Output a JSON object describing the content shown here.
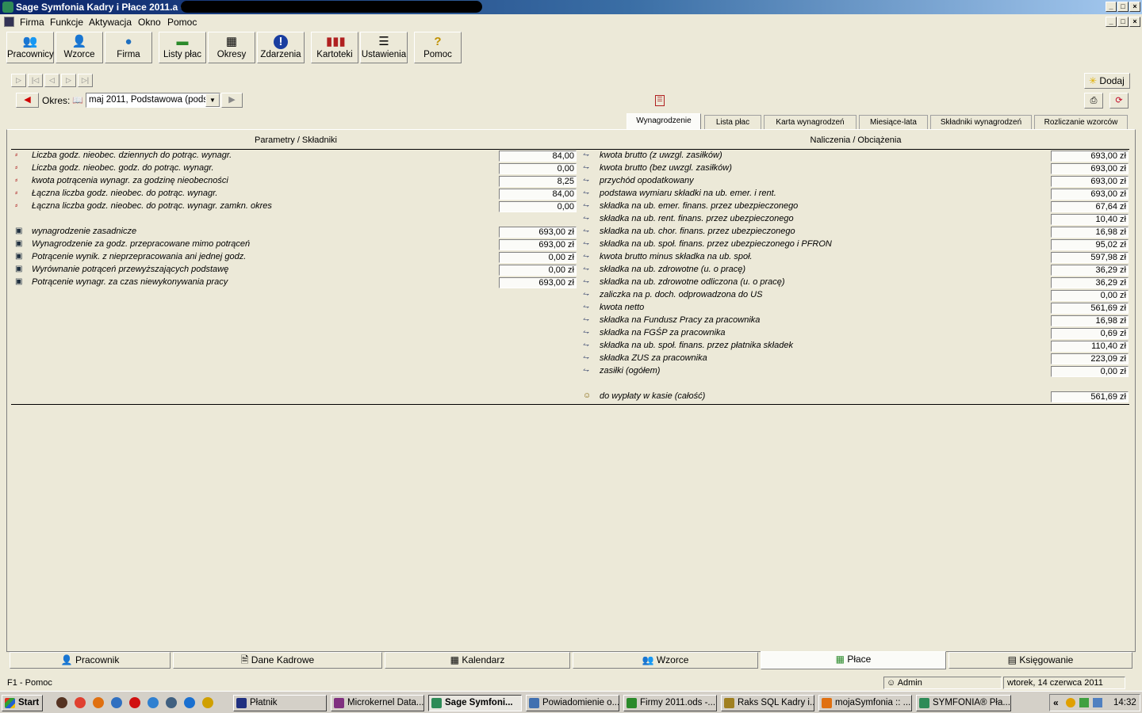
{
  "window": {
    "title": "Sage Symfonia Kadry i Płace 2011.a - "
  },
  "menu": [
    "Firma",
    "Funkcje",
    "Aktywacja",
    "Okno",
    "Pomoc"
  ],
  "toolbar": [
    {
      "label": "Pracownicy",
      "icon": "people-icon"
    },
    {
      "label": "Wzorce",
      "icon": "templates-icon"
    },
    {
      "label": "Firma",
      "icon": "globe-icon"
    },
    {
      "label": "Listy płac",
      "icon": "money-icon"
    },
    {
      "label": "Okresy",
      "icon": "calendar-icon"
    },
    {
      "label": "Zdarzenia",
      "icon": "alert-icon"
    },
    {
      "label": "Kartoteki",
      "icon": "books-icon"
    },
    {
      "label": "Ustawienia",
      "icon": "sliders-icon"
    },
    {
      "label": "Pomoc",
      "icon": "help-icon"
    }
  ],
  "period": {
    "label": "Okres:",
    "value": "maj 2011, Podstawowa (pods..."
  },
  "add_button": "Dodaj",
  "tabs": [
    "Wynagrodzenie",
    "Lista płac",
    "Karta wynagrodzeń",
    "Miesiące-lata",
    "Składniki wynagrodzeń",
    "Rozliczanie wzorców"
  ],
  "left": {
    "header": "Parametry / Składniki",
    "rows": [
      {
        "label": "Liczba godz. nieobec. dziennych do potrąc. wynagr.",
        "value": "84,00",
        "icon": "param-icon"
      },
      {
        "label": "Liczba godz. nieobec. godz. do potrąc. wynagr.",
        "value": "0,00",
        "icon": "param-icon"
      },
      {
        "label": "kwota potrącenia wynagr. za godzinę nieobecności",
        "value": "8,25",
        "icon": "param-icon"
      },
      {
        "label": "Łączna liczba godz. nieobec. do potrąc. wynagr.",
        "value": "84,00",
        "icon": "param-icon"
      },
      {
        "label": "Łączna liczba godz. nieobec. do potrąc. wynagr. zamkn. okres",
        "value": "0,00",
        "icon": "param-icon"
      },
      {
        "label": "",
        "value": "",
        "icon": ""
      },
      {
        "label": "wynagrodzenie zasadnicze",
        "value": "693,00 zł",
        "icon": "component-icon"
      },
      {
        "label": "Wynagrodzenie za godz. przepracowane mimo potrąceń",
        "value": "693,00 zł",
        "icon": "component-icon"
      },
      {
        "label": "Potrącenie wynik. z nieprzepracowania ani jednej godz.",
        "value": "0,00 zł",
        "icon": "component-icon"
      },
      {
        "label": "Wyrównanie potrąceń przewyższających podstawę",
        "value": "0,00 zł",
        "icon": "component-icon"
      },
      {
        "label": "Potrącenie wynagr. za czas niewykonywania pracy",
        "value": "693,00 zł",
        "icon": "component-icon"
      }
    ]
  },
  "right": {
    "header": "Naliczenia / Obciążenia",
    "rows": [
      {
        "label": "kwota brutto (z uwzgl. zasiłków)",
        "value": "693,00 zł"
      },
      {
        "label": "kwota brutto (bez uwzgl. zasiłków)",
        "value": "693,00 zł"
      },
      {
        "label": "przychód opodatkowany",
        "value": "693,00 zł"
      },
      {
        "label": "podstawa wymiaru składki na ub. emer. i rent.",
        "value": "693,00 zł"
      },
      {
        "label": "składka na ub. emer. finans. przez ubezpieczonego",
        "value": "67,64 zł"
      },
      {
        "label": "składka na ub. rent. finans. przez ubezpieczonego",
        "value": "10,40 zł"
      },
      {
        "label": "składka na ub. chor. finans. przez ubezpieczonego",
        "value": "16,98 zł"
      },
      {
        "label": "składka na ub. społ. finans. przez ubezpieczonego i PFRON",
        "value": "95,02 zł"
      },
      {
        "label": "kwota brutto minus składka na ub. społ.",
        "value": "597,98 zł"
      },
      {
        "label": "składka na ub. zdrowotne (u. o pracę)",
        "value": "36,29 zł"
      },
      {
        "label": "składka na ub. zdrowotne odliczona (u. o pracę)",
        "value": "36,29 zł"
      },
      {
        "label": "zaliczka na p. doch. odprowadzona do US",
        "value": "0,00 zł"
      },
      {
        "label": "kwota netto",
        "value": "561,69 zł"
      },
      {
        "label": "składka na Fundusz Pracy za pracownika",
        "value": "16,98 zł"
      },
      {
        "label": "składka na FGŚP za pracownika",
        "value": "0,69 zł"
      },
      {
        "label": "składka na ub. społ. finans. przez płatnika składek",
        "value": "110,40 zł"
      },
      {
        "label": "składka ZUS za pracownika",
        "value": "223,09 zł"
      },
      {
        "label": "zasiłki (ogółem)",
        "value": "0,00 zł"
      }
    ],
    "total": {
      "label": "do wypłaty w kasie (całość)",
      "value": "561,69 zł"
    }
  },
  "bottom_tabs": [
    "Pracownik",
    "Dane Kadrowe",
    "Kalendarz",
    "Wzorce",
    "Płace",
    "Księgowanie"
  ],
  "status": {
    "help": "F1 - Pomoc",
    "user": "Admin",
    "date": "wtorek, 14 czerwca 2011"
  },
  "taskbar": {
    "start": "Start",
    "tasks": [
      "Płatnik",
      "Microkernel Data...",
      "Sage Symfoni...",
      "Powiadomienie o...",
      "Firmy 2011.ods -...",
      "Raks SQL Kadry i...",
      "mojaSymfonia :: ...",
      "SYMFONIA® Pła..."
    ],
    "clock": "14:32",
    "tray_toggle": "«"
  },
  "colors": {
    "accent": "#0a246a",
    "face": "#ece9d8"
  }
}
